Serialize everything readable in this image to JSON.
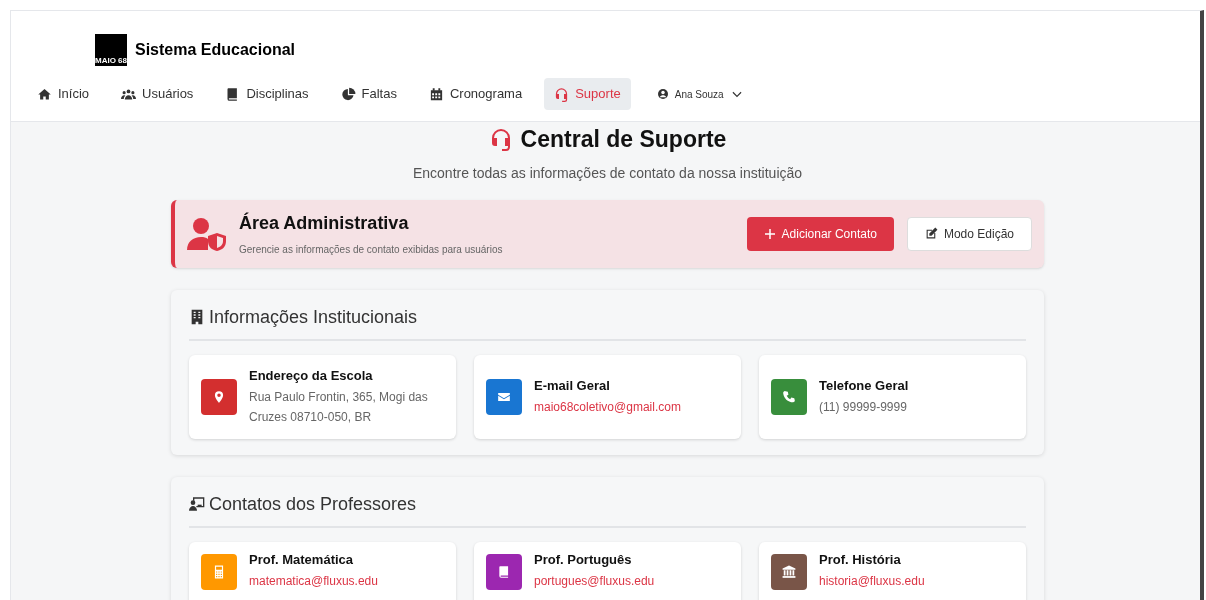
{
  "brand": {
    "title": "Sistema Educacional",
    "logo_text": "MAIO 68"
  },
  "nav": [
    {
      "label": "Início",
      "kind": "home",
      "selected": false
    },
    {
      "label": "Usuários",
      "kind": "users",
      "selected": false
    },
    {
      "label": "Disciplinas",
      "kind": "book",
      "selected": false
    },
    {
      "label": "Faltas",
      "kind": "pie",
      "selected": false
    },
    {
      "label": "Cronograma",
      "kind": "calendar",
      "selected": false
    },
    {
      "label": "Suporte",
      "kind": "headset",
      "selected": true
    }
  ],
  "user_menu": {
    "name": "Ana Souza"
  },
  "page": {
    "title": "Central de Suporte",
    "subtitle": "Encontre todas as informações de contato da nossa instituição"
  },
  "admin_panel": {
    "title": "Área Administrativa",
    "description": "Gerencie as informações de contato exibidas para usuários",
    "buttons": [
      {
        "label": "Adicionar Contato",
        "kind": "primary"
      },
      {
        "label": "Modo Edição",
        "kind": "secondary"
      }
    ]
  },
  "sections": [
    {
      "title": "Informações Institucionais",
      "kind": "building",
      "cards": [
        {
          "title": "Endereço da Escola",
          "value": "Rua Paulo Frontin, 365, Mogi das Cruzes 08710-050, BR",
          "kind": "pin",
          "color": "#d32f2f"
        },
        {
          "title": "E-mail Geral",
          "value": "maio68coletivo@gmail.com",
          "kind": "mail",
          "color": "#1976d2"
        },
        {
          "title": "Telefone Geral",
          "value": "(11) 99999-9999",
          "kind": "phone",
          "color": "#388e3c"
        }
      ]
    },
    {
      "title": "Contatos dos Professores",
      "kind": "teacher",
      "cards": [
        {
          "title": "Prof. Matemática",
          "value": "matematica@fluxus.edu",
          "kind": "calculator",
          "color": "#ff9800"
        },
        {
          "title": "Prof. Português",
          "value": "portugues@fluxus.edu",
          "kind": "book",
          "color": "#9c27b0"
        },
        {
          "title": "Prof. História",
          "value": "historia@fluxus.edu",
          "kind": "bank",
          "color": "#795548"
        }
      ]
    }
  ]
}
